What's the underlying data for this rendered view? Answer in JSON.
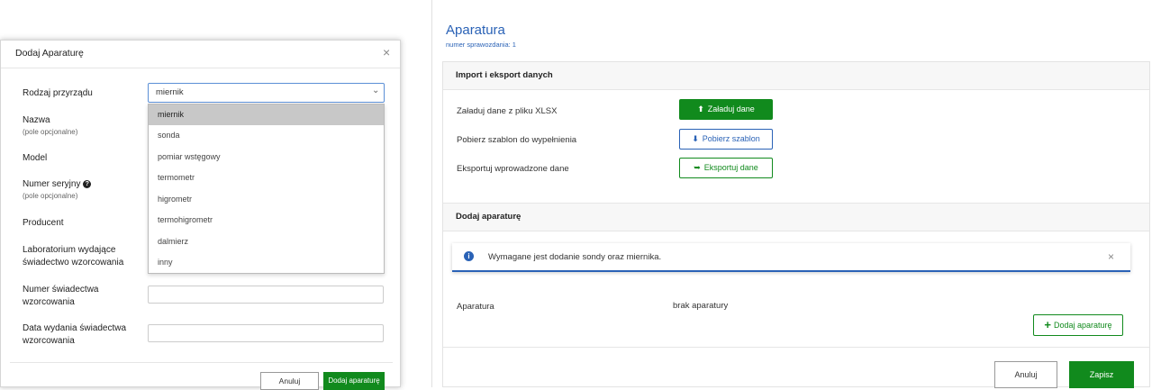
{
  "modal": {
    "title": "Dodaj Aparaturę",
    "close": "×",
    "fields": [
      {
        "label": "Rodzaj przyrządu"
      },
      {
        "label": "Nazwa",
        "sub": "(pole opcjonalne)"
      },
      {
        "label": "Model"
      },
      {
        "label": "Numer seryjny",
        "sub": "(pole opcjonalne)"
      },
      {
        "label": "Producent"
      },
      {
        "label": "Laboratorium wydające świadectwo wzorcowania"
      },
      {
        "label": "Numer świadectwa wzorcowania"
      },
      {
        "label": "Data wydania świadectwa wzorcowania"
      }
    ],
    "select": {
      "value": "miernik",
      "options": [
        "miernik",
        "sonda",
        "pomiar wstęgowy",
        "termometr",
        "higrometr",
        "termohigrometr",
        "dalmierz",
        "inny"
      ]
    },
    "buttons": {
      "cancel": "Anuluj",
      "submit": "Dodaj aparaturę"
    }
  },
  "panel": {
    "title": "Aparatura",
    "subtitle": "numer sprawozdania: 1",
    "import_section": {
      "heading": "Import i eksport danych",
      "rows": [
        {
          "label": "Załaduj dane z pliku XLSX",
          "button": "Załaduj dane"
        },
        {
          "label": "Pobierz szablon do wypełnienia",
          "button": "Pobierz szablon"
        },
        {
          "label": "Eksportuj wprowadzone dane",
          "button": "Eksportuj dane"
        }
      ]
    },
    "add_section": {
      "heading": "Dodaj aparaturę",
      "alert": "Wymagane jest dodanie sondy oraz miernika.",
      "alert_close": "×",
      "apparatus_label": "Aparatura",
      "apparatus_value": "brak aparatury",
      "add_button": "Dodaj aparaturę"
    },
    "buttons": {
      "cancel": "Anuluj",
      "save": "Zapisz"
    }
  },
  "colors": {
    "brand_green": "#118a1d",
    "brand_blue": "#2a62b6"
  }
}
